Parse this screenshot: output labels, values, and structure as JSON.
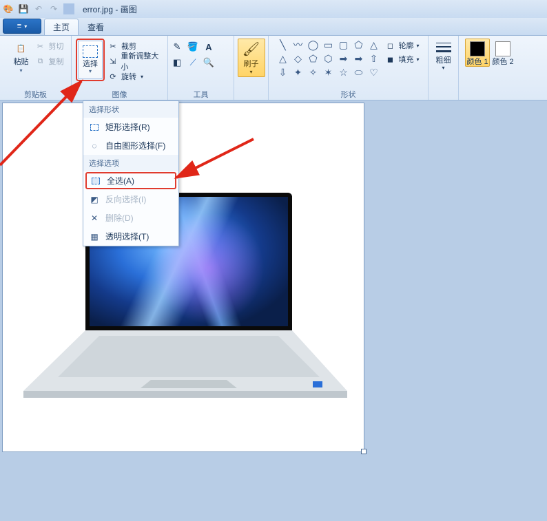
{
  "titlebar": {
    "filename": "error.jpg",
    "app": "画图"
  },
  "tabs": {
    "home": "主页",
    "view": "查看"
  },
  "groups": {
    "clipboard": {
      "label": "剪贴板",
      "paste": "粘贴",
      "cut": "剪切",
      "copy": "复制"
    },
    "image": {
      "label": "图像",
      "select": "选择",
      "crop": "裁剪",
      "resize": "重新调整大小",
      "rotate": "旋转"
    },
    "tools": {
      "label": "工具"
    },
    "brush": {
      "label": "刷子"
    },
    "shapes": {
      "label": "形状",
      "outline": "轮廓",
      "fill": "填充"
    },
    "stroke": {
      "label": "粗细"
    },
    "color1": {
      "label": "颜色 1"
    },
    "color2": {
      "label": "颜色 2"
    }
  },
  "menu": {
    "hdr1": "选择形状",
    "rect": "矩形选择(R)",
    "free": "自由图形选择(F)",
    "hdr2": "选择选项",
    "all": "全选(A)",
    "invert": "反向选择(I)",
    "delete": "删除(D)",
    "transparent": "透明选择(T)"
  },
  "colors": {
    "c1": "#000000",
    "c2": "#ffffff"
  }
}
